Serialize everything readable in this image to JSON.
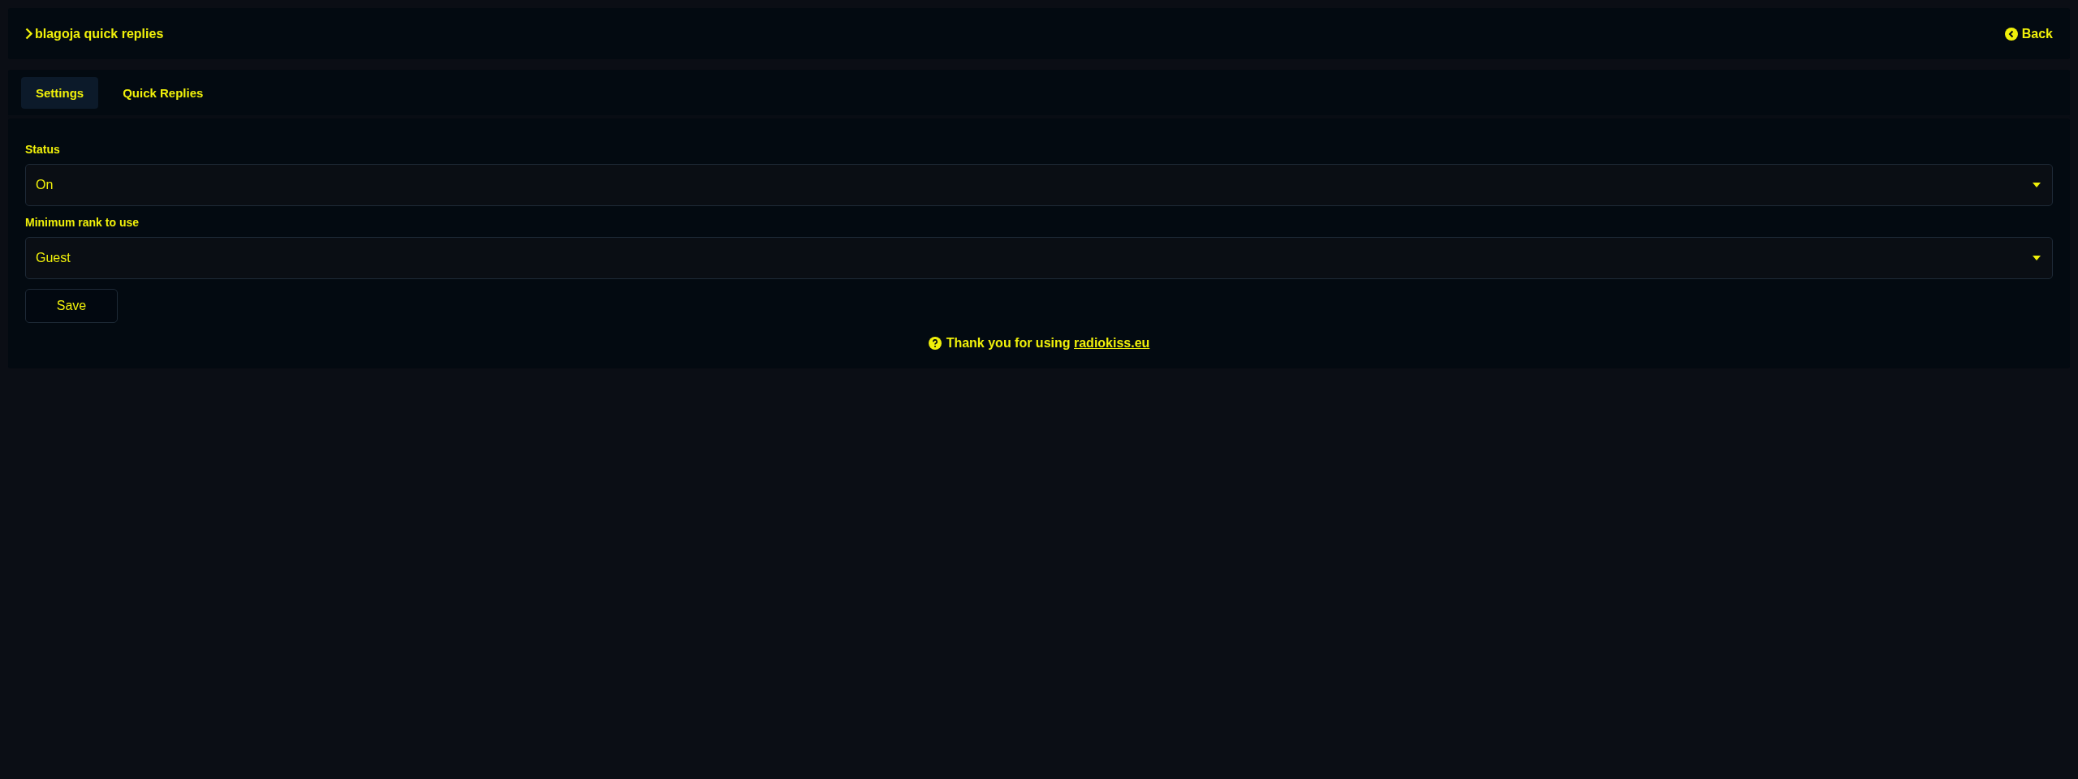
{
  "header": {
    "title": "blagoja quick replies",
    "back": "Back"
  },
  "tabs": [
    {
      "label": "Settings",
      "selected": true
    },
    {
      "label": "Quick Replies",
      "selected": false
    }
  ],
  "fields": [
    {
      "label": "Status",
      "value": "On"
    },
    {
      "label": "Minimum rank to use",
      "value": "Guest"
    }
  ],
  "save_button": "Save",
  "footer": {
    "text": "Thank you for using ",
    "link": "radiokiss.eu"
  }
}
